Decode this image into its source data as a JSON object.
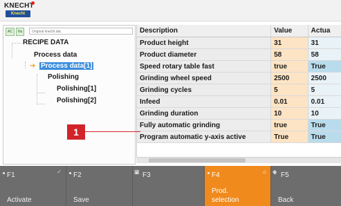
{
  "brand": {
    "logo_text": "KNECHT",
    "logo_plate": "Knecht"
  },
  "toolbar": {
    "btn_a": "AC",
    "btn_b": "Nu",
    "search_placeholder": "Original knecht dat."
  },
  "tree": {
    "root": "RECIPE DATA",
    "process_data": "Process data",
    "process_data_1": "Process data[1]",
    "polishing": "Polishing",
    "polishing_1": "Polishing[1]",
    "polishing_2": "Polishing[2]"
  },
  "table": {
    "headers": [
      "Description",
      "Value",
      "Actua"
    ],
    "rows": [
      {
        "desc": "Product height",
        "value": "31",
        "actual": "31"
      },
      {
        "desc": "Product diameter",
        "value": "58",
        "actual": "58"
      },
      {
        "desc": "Speed rotary table fast",
        "value": "true",
        "actual": "True"
      },
      {
        "desc": "Grinding wheel speed",
        "value": "2500",
        "actual": "2500"
      },
      {
        "desc": "Grinding cycles",
        "value": "5",
        "actual": "5"
      },
      {
        "desc": "Infeed",
        "value": "0.01",
        "actual": "0.01"
      },
      {
        "desc": "Grinding duration",
        "value": "10",
        "actual": "10"
      },
      {
        "desc": "Fully automatic grinding",
        "value": "true",
        "actual": "True"
      },
      {
        "desc": "Program automatic y-axis active",
        "value": "True",
        "actual": "True"
      }
    ]
  },
  "callout": {
    "number": "1"
  },
  "function_keys": [
    {
      "key": "F1",
      "label": "Activate",
      "label2": ""
    },
    {
      "key": "F2",
      "label": "Save",
      "label2": ""
    },
    {
      "key": "F3",
      "label": "",
      "label2": ""
    },
    {
      "key": "F4",
      "label": "selection",
      "label2": "Prod."
    },
    {
      "key": "F5",
      "label": "Back",
      "label2": ""
    }
  ],
  "colors": {
    "accent_orange": "#f08a1c",
    "selection_blue": "#3a8dde",
    "callout_red": "#d2232a",
    "fkey_bar": "#6d6d6d"
  }
}
